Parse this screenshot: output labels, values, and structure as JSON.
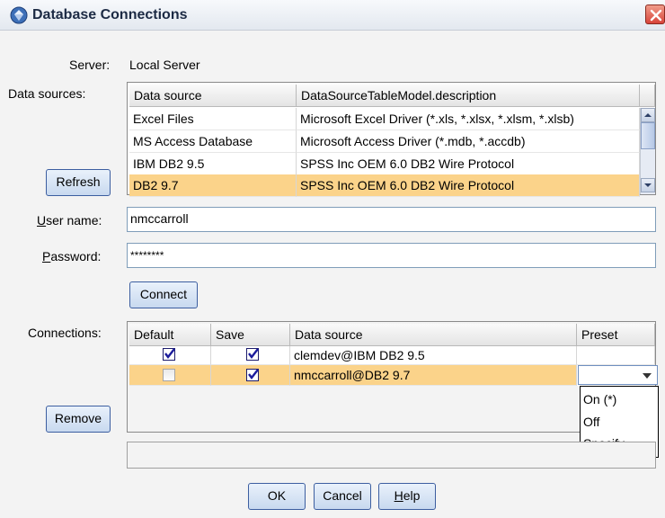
{
  "window": {
    "title": "Database Connections",
    "title_icon": "diamond-app-icon",
    "close_icon": "close-icon"
  },
  "server": {
    "label": "Server:",
    "value": "Local Server"
  },
  "data_sources": {
    "label": "Data sources:",
    "columns": [
      "Data source",
      "DataSourceTableModel.description"
    ],
    "rows": [
      {
        "source": "Excel Files",
        "description": "Microsoft Excel Driver (*.xls, *.xlsx, *.xlsm, *.xlsb)",
        "selected": false
      },
      {
        "source": "MS Access Database",
        "description": "Microsoft Access Driver (*.mdb, *.accdb)",
        "selected": false
      },
      {
        "source": "IBM DB2 9.5",
        "description": "SPSS Inc OEM 6.0 DB2 Wire Protocol",
        "selected": false
      },
      {
        "source": "DB2 9.7",
        "description": "SPSS Inc OEM 6.0 DB2 Wire Protocol",
        "selected": true
      }
    ]
  },
  "refresh_button": "Refresh",
  "user_name": {
    "label_pre": "U",
    "label_post": "ser name:",
    "value": "nmccarroll"
  },
  "password": {
    "label_pre": "P",
    "label_post": "assword:",
    "value": "********"
  },
  "connect_button": "Connect",
  "connections": {
    "label": "Connections:",
    "columns": [
      "Default",
      "Save",
      "Data source",
      "Preset"
    ],
    "rows": [
      {
        "default": true,
        "save": true,
        "source": "clemdev@IBM DB2 9.5",
        "preset": ""
      },
      {
        "default": false,
        "save": true,
        "source": "nmccarroll@DB2 9.7",
        "preset": "",
        "selected": true
      }
    ],
    "preset_options": [
      "On (*)",
      "Off",
      "Specify..."
    ]
  },
  "remove_button": "Remove",
  "footer": {
    "ok": "OK",
    "cancel": "Cancel",
    "help_pre": "H",
    "help_post": "elp"
  },
  "colors": {
    "selection": "#fbd38a",
    "button_border": "#3c5ea0"
  }
}
